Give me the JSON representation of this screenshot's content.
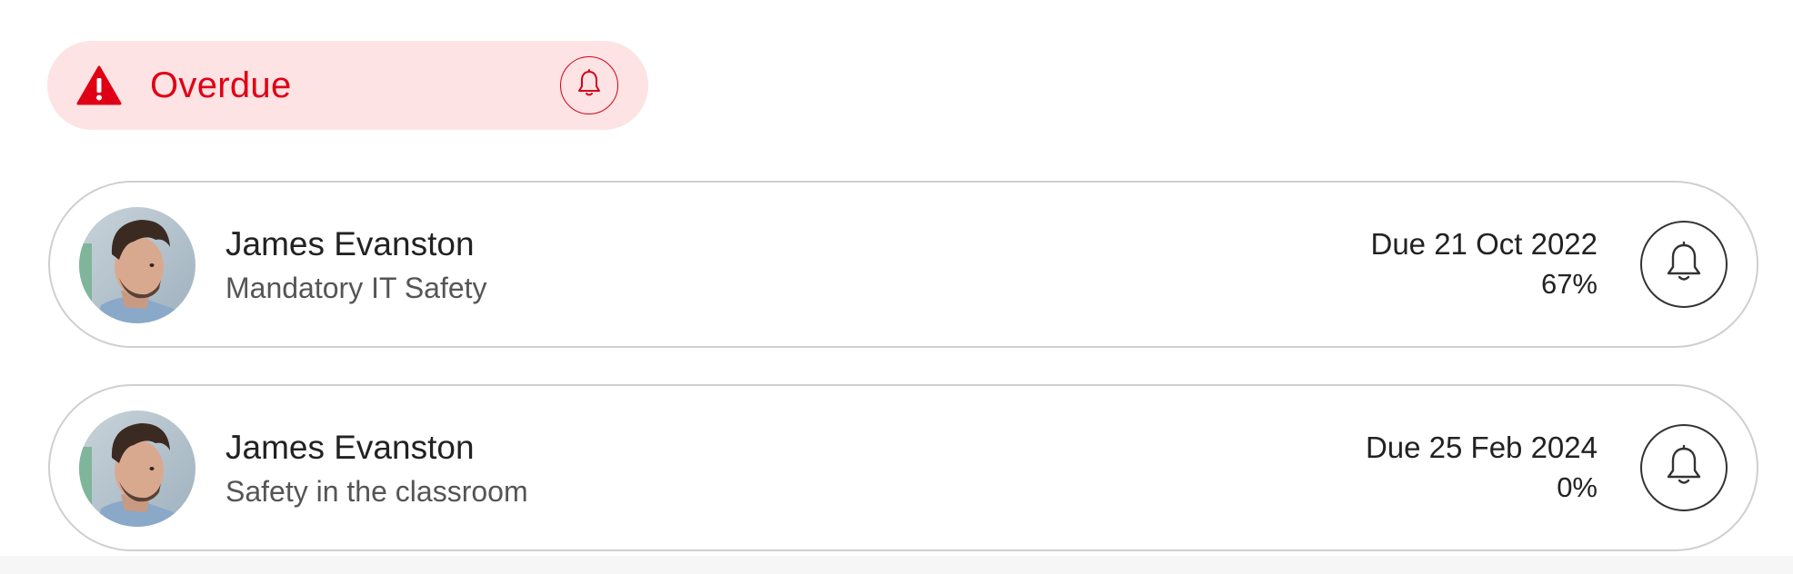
{
  "overdue": {
    "label": "Overdue",
    "warning_icon": "warning-triangle-icon",
    "bell_icon": "bell-icon",
    "colors": {
      "accent": "#e00016",
      "background": "#fde3e3"
    }
  },
  "assignments": [
    {
      "name": "James Evanston",
      "course": "Mandatory IT Safety",
      "due": "Due 21 Oct 2022",
      "progress": "67%",
      "avatar_icon": "user-avatar",
      "bell_icon": "bell-icon"
    },
    {
      "name": "James Evanston",
      "course": "Safety in the classroom",
      "due": "Due 25 Feb 2024",
      "progress": "0%",
      "avatar_icon": "user-avatar",
      "bell_icon": "bell-icon"
    }
  ]
}
